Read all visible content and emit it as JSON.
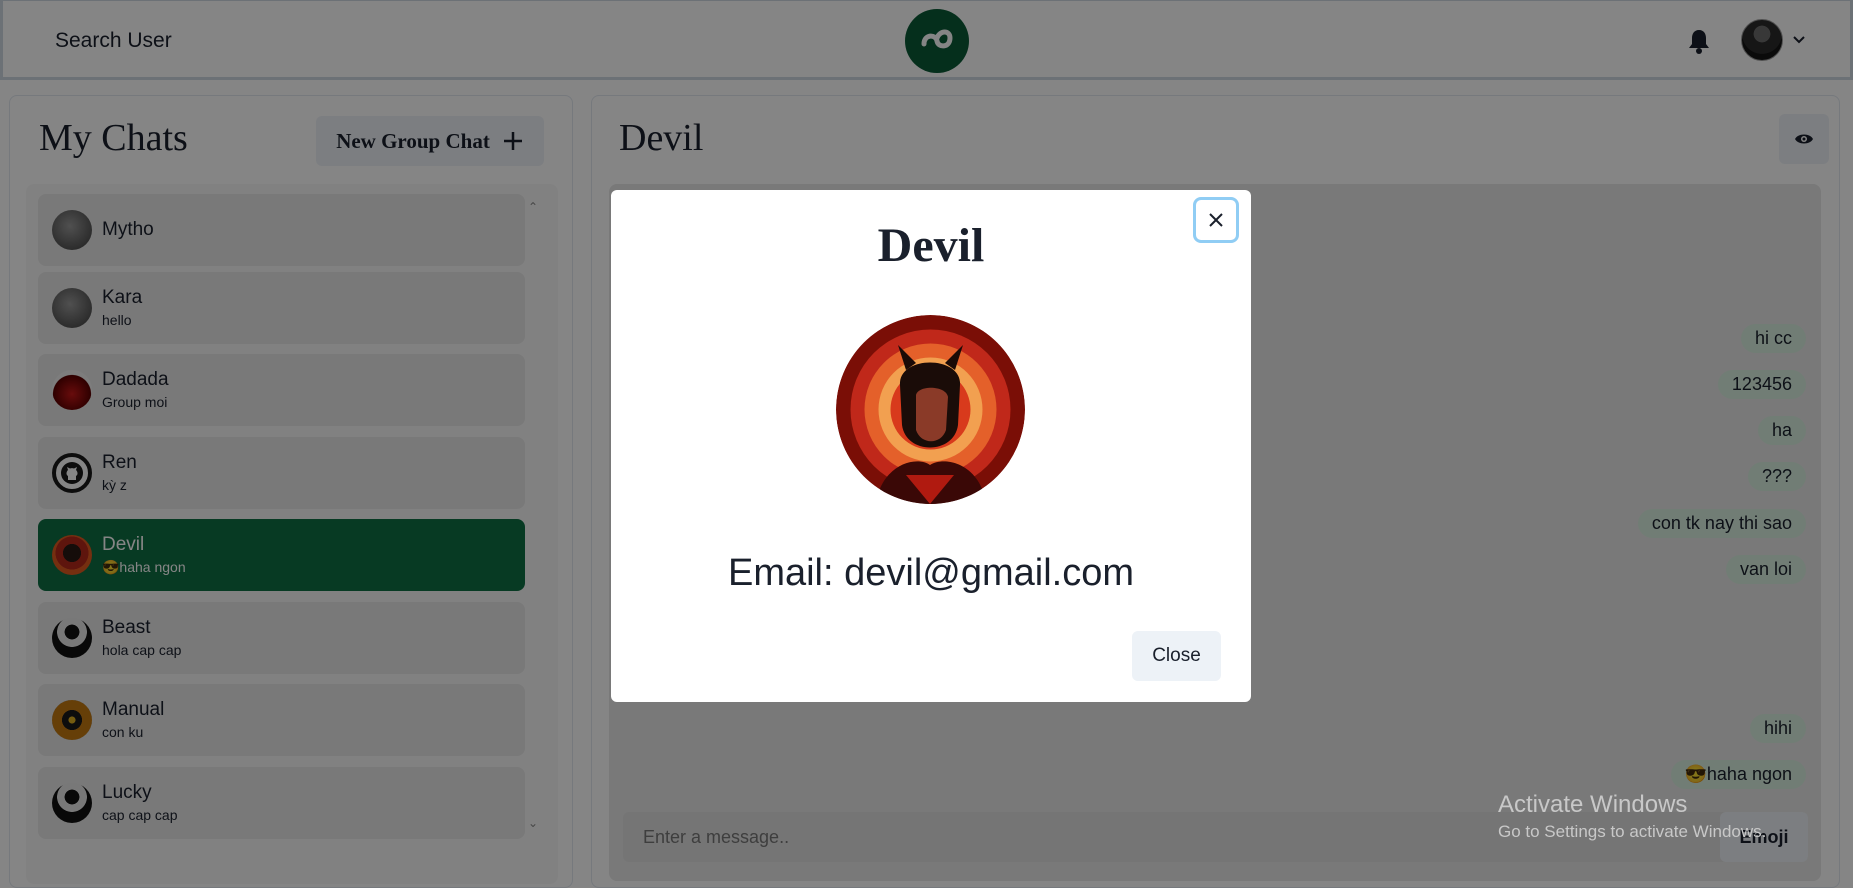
{
  "header": {
    "search_label": "Search User"
  },
  "sidebar": {
    "title": "My Chats",
    "new_group_label": "New Group Chat",
    "chats": [
      {
        "name": "Mytho",
        "last": ""
      },
      {
        "name": "Kara",
        "last": "hello"
      },
      {
        "name": "Dadada",
        "last": "Group moi"
      },
      {
        "name": "Ren",
        "last": "kỳ z"
      },
      {
        "name": "Devil",
        "last": "😎haha ngon",
        "selected": true
      },
      {
        "name": "Beast",
        "last": "hola cap cap"
      },
      {
        "name": "Manual",
        "last": "con ku"
      },
      {
        "name": "Lucky",
        "last": "cap cap cap"
      }
    ]
  },
  "chat": {
    "title": "Devil",
    "messages": [
      "hi cc",
      "123456",
      "ha",
      "???",
      "con tk nay thi sao",
      "van loi",
      "hihi",
      "😎haha ngon"
    ],
    "input_placeholder": "Enter a message..",
    "emoji_label": "Emoji"
  },
  "modal": {
    "title": "Devil",
    "email": "Email: devil@gmail.com",
    "close_label": "Close"
  },
  "watermark": {
    "title": "Activate Windows",
    "subtitle": "Go to Settings to activate Windows."
  },
  "colors": {
    "brand": "#0b5a36",
    "selected_chat": "#0f6f44",
    "focus_ring": "#90cdf4"
  }
}
